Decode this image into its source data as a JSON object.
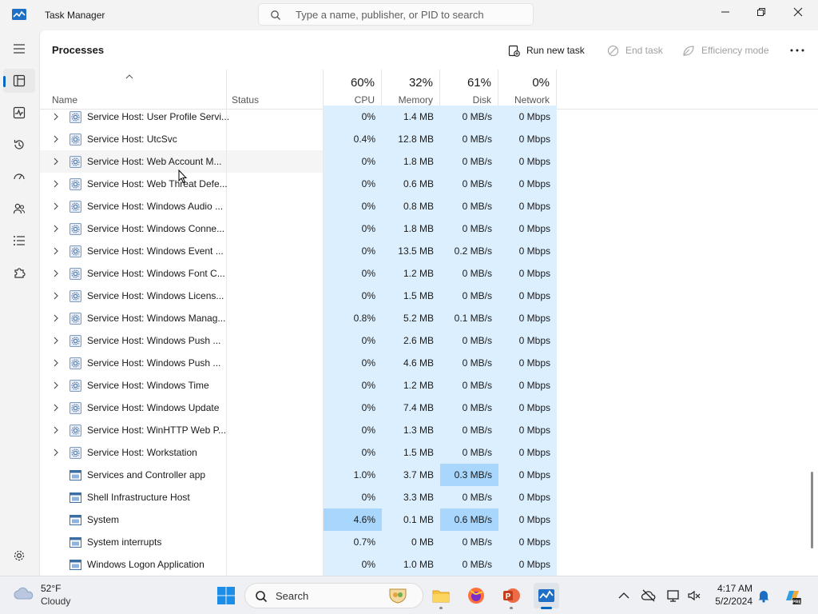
{
  "window": {
    "title": "Task Manager"
  },
  "search": {
    "placeholder": "Type a name, publisher, or PID to search"
  },
  "toolbar": {
    "page_title": "Processes",
    "run_new_task": "Run new task",
    "end_task": "End task",
    "efficiency_mode": "Efficiency mode"
  },
  "columns": {
    "name": "Name",
    "status": "Status",
    "cpu_pct": "60%",
    "cpu": "CPU",
    "memory_pct": "32%",
    "memory": "Memory",
    "disk_pct": "61%",
    "disk": "Disk",
    "network_pct": "0%",
    "network": "Network"
  },
  "rows": [
    {
      "name": "Service Host: User Profile Servi...",
      "cpu": "0%",
      "memory": "1.4 MB",
      "disk": "0 MB/s",
      "network": "0 Mbps"
    },
    {
      "name": "Service Host: UtcSvc",
      "cpu": "0.4%",
      "memory": "12.8 MB",
      "disk": "0 MB/s",
      "network": "0 Mbps"
    },
    {
      "name": "Service Host: Web Account M...",
      "cpu": "0%",
      "memory": "1.8 MB",
      "disk": "0 MB/s",
      "network": "0 Mbps"
    },
    {
      "name": "Service Host: Web Threat Defe...",
      "cpu": "0%",
      "memory": "0.6 MB",
      "disk": "0 MB/s",
      "network": "0 Mbps"
    },
    {
      "name": "Service Host: Windows Audio ...",
      "cpu": "0%",
      "memory": "0.8 MB",
      "disk": "0 MB/s",
      "network": "0 Mbps"
    },
    {
      "name": "Service Host: Windows Conne...",
      "cpu": "0%",
      "memory": "1.8 MB",
      "disk": "0 MB/s",
      "network": "0 Mbps"
    },
    {
      "name": "Service Host: Windows Event ...",
      "cpu": "0%",
      "memory": "13.5 MB",
      "disk": "0.2 MB/s",
      "network": "0 Mbps"
    },
    {
      "name": "Service Host: Windows Font C...",
      "cpu": "0%",
      "memory": "1.2 MB",
      "disk": "0 MB/s",
      "network": "0 Mbps"
    },
    {
      "name": "Service Host: Windows Licens...",
      "cpu": "0%",
      "memory": "1.5 MB",
      "disk": "0 MB/s",
      "network": "0 Mbps"
    },
    {
      "name": "Service Host: Windows Manag...",
      "cpu": "0.8%",
      "memory": "5.2 MB",
      "disk": "0.1 MB/s",
      "network": "0 Mbps"
    },
    {
      "name": "Service Host: Windows Push ...",
      "cpu": "0%",
      "memory": "2.6 MB",
      "disk": "0 MB/s",
      "network": "0 Mbps"
    },
    {
      "name": "Service Host: Windows Push ...",
      "cpu": "0%",
      "memory": "4.6 MB",
      "disk": "0 MB/s",
      "network": "0 Mbps"
    },
    {
      "name": "Service Host: Windows Time",
      "cpu": "0%",
      "memory": "1.2 MB",
      "disk": "0 MB/s",
      "network": "0 Mbps"
    },
    {
      "name": "Service Host: Windows Update",
      "cpu": "0%",
      "memory": "7.4 MB",
      "disk": "0 MB/s",
      "network": "0 Mbps"
    },
    {
      "name": "Service Host: WinHTTP Web P...",
      "cpu": "0%",
      "memory": "1.3 MB",
      "disk": "0 MB/s",
      "network": "0 Mbps"
    },
    {
      "name": "Service Host: Workstation",
      "cpu": "0%",
      "memory": "1.5 MB",
      "disk": "0 MB/s",
      "network": "0 Mbps"
    },
    {
      "name": "Services and Controller app",
      "cpu": "1.0%",
      "memory": "3.7 MB",
      "disk": "0.3 MB/s",
      "network": "0 Mbps"
    },
    {
      "name": "Shell Infrastructure Host",
      "cpu": "0%",
      "memory": "3.3 MB",
      "disk": "0 MB/s",
      "network": "0 Mbps"
    },
    {
      "name": "System",
      "cpu": "4.6%",
      "memory": "0.1 MB",
      "disk": "0.6 MB/s",
      "network": "0 Mbps"
    },
    {
      "name": "System interrupts",
      "cpu": "0.7%",
      "memory": "0 MB",
      "disk": "0 MB/s",
      "network": "0 Mbps"
    },
    {
      "name": "Windows Logon Application",
      "cpu": "0%",
      "memory": "1.0 MB",
      "disk": "0 MB/s",
      "network": "0 Mbps"
    }
  ],
  "taskbar": {
    "weather_temp": "52°F",
    "weather_cond": "Cloudy",
    "search_label": "Search",
    "time": "4:17 AM",
    "date": "5/2/2024"
  },
  "colors": {
    "accent": "#0067c0",
    "heat_low": "#dcefff",
    "heat_high": "#a8d6fd"
  }
}
